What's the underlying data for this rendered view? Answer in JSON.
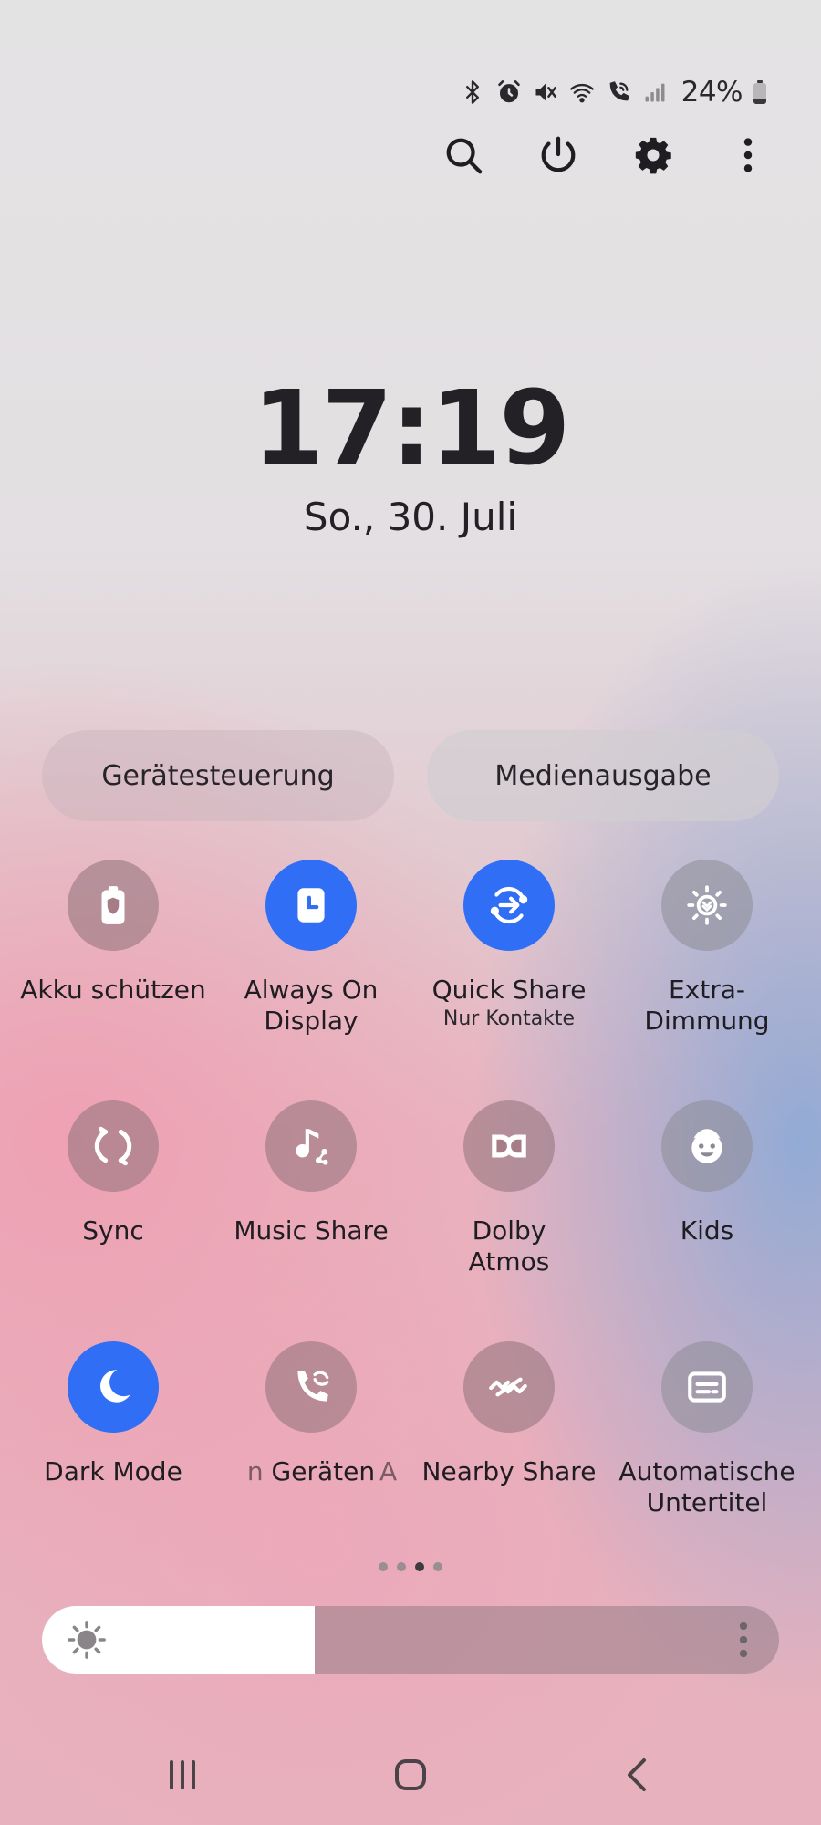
{
  "status_bar": {
    "battery_percent": "24%",
    "battery_level": 0.24,
    "icons": [
      "bluetooth-icon",
      "alarm-icon",
      "mute-icon",
      "wifi-icon",
      "wifi-calling-icon",
      "signal-icon"
    ]
  },
  "actions": [
    "search-icon",
    "power-icon",
    "settings-icon",
    "more-icon"
  ],
  "clock": {
    "time": "17:19",
    "date": "So., 30. Juli"
  },
  "pills": {
    "device_control": "Gerätesteuerung",
    "media_output": "Medienausgabe"
  },
  "tiles": [
    {
      "label": "Akku schützen",
      "sub": "",
      "icon": "battery-shield-icon",
      "active": false
    },
    {
      "label": "Always On\nDisplay",
      "sub": "",
      "icon": "clock-screen-icon",
      "active": true
    },
    {
      "label": "Quick Share",
      "sub": "Nur Kontakte",
      "icon": "quick-share-icon",
      "active": true
    },
    {
      "label": "Extra-Dimmung",
      "sub": "",
      "icon": "extra-dim-icon",
      "active": false
    },
    {
      "label": "Sync",
      "sub": "",
      "icon": "sync-icon",
      "active": false
    },
    {
      "label": "Music Share",
      "sub": "",
      "icon": "music-share-icon",
      "active": false
    },
    {
      "label": "Dolby\nAtmos",
      "sub": "",
      "icon": "dolby-icon",
      "active": false
    },
    {
      "label": "Kids",
      "sub": "",
      "icon": "kids-icon",
      "active": false
    },
    {
      "label": "Dark Mode",
      "sub": "",
      "icon": "moon-icon",
      "active": true
    },
    {
      "label": "Geräten",
      "label_prefix": "n ",
      "sub": "",
      "icon": "call-sync-icon",
      "active": false
    },
    {
      "label": "Nearby Share",
      "label_prefix": "A",
      "sub": "",
      "icon": "nearby-share-icon",
      "active": false
    },
    {
      "label": "Automatische\nUntertitel",
      "sub": "",
      "icon": "caption-icon",
      "active": false
    }
  ],
  "page_indicator": {
    "count": 4,
    "active_index": 2
  },
  "brightness": {
    "level": 0.37
  },
  "navbar": [
    "recents-icon",
    "home-icon",
    "back-icon"
  ]
}
